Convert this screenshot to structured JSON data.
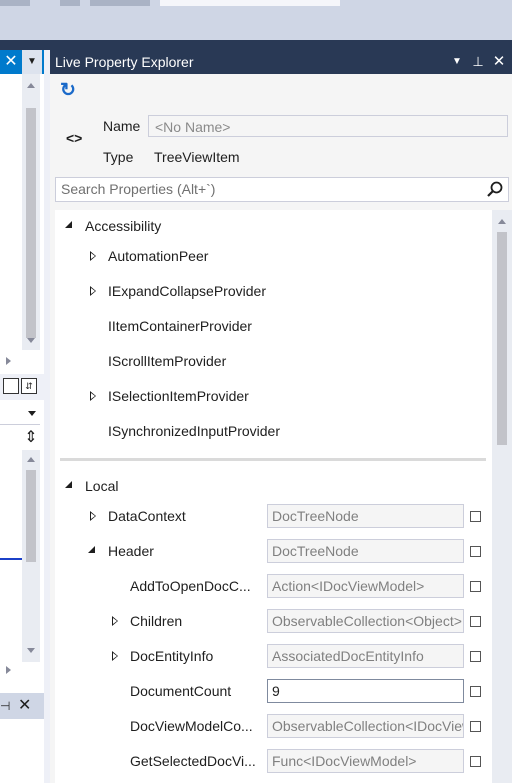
{
  "panel": {
    "title": "Live Property Explorer"
  },
  "element": {
    "name_label": "Name",
    "name_placeholder": "<No Name>",
    "type_label": "Type",
    "type_value": "TreeViewItem"
  },
  "search": {
    "placeholder": "Search Properties (Alt+`)"
  },
  "groups": [
    {
      "label": "Accessibility",
      "items": [
        {
          "label": "AutomationPeer",
          "expandable": true
        },
        {
          "label": "IExpandCollapseProvider",
          "expandable": true
        },
        {
          "label": "IItemContainerProvider",
          "expandable": false
        },
        {
          "label": "IScrollItemProvider",
          "expandable": false
        },
        {
          "label": "ISelectionItemProvider",
          "expandable": true
        },
        {
          "label": "ISynchronizedInputProvider",
          "expandable": false
        }
      ]
    },
    {
      "label": "Local",
      "items": [
        {
          "label": "DataContext",
          "value": "DocTreeNode"
        },
        {
          "label": "Header",
          "value": "DocTreeNode"
        },
        {
          "label": "AddToOpenDocC...",
          "value": "Action<IDocViewModel>"
        },
        {
          "label": "Children",
          "value": "ObservableCollection<Object>"
        },
        {
          "label": "DocEntityInfo",
          "value": "AssociatedDocEntityInfo"
        },
        {
          "label": "DocumentCount",
          "value": "9"
        },
        {
          "label": "DocViewModelCo...",
          "value": "ObservableCollection<IDocViewModel>"
        },
        {
          "label": "GetSelectedDocVi...",
          "value": "Func<IDocViewModel>"
        }
      ]
    }
  ]
}
